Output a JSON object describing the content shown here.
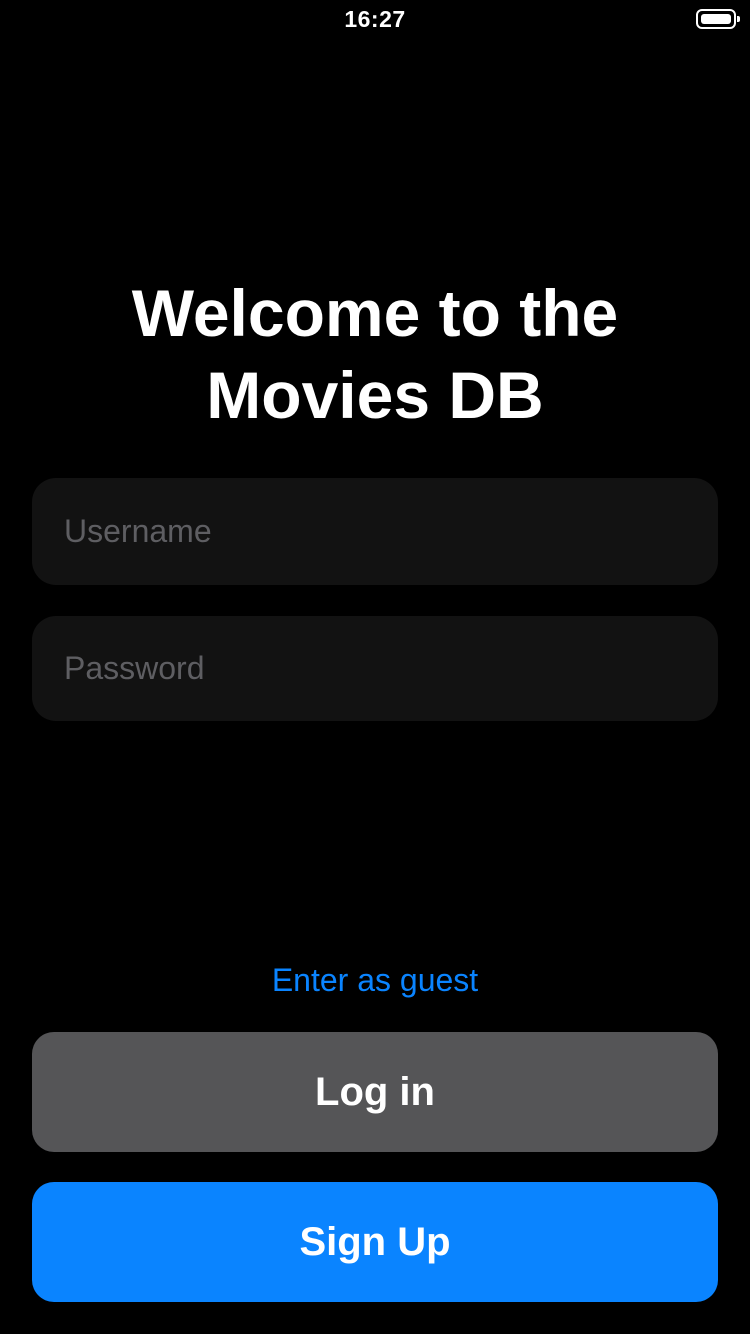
{
  "status_bar": {
    "time": "16:27",
    "battery_icon": "battery-full-icon"
  },
  "welcome": {
    "title_line1": "Welcome to the",
    "title_line2": "Movies DB"
  },
  "form": {
    "username_placeholder": "Username",
    "username_value": "",
    "password_placeholder": "Password",
    "password_value": ""
  },
  "actions": {
    "guest_label": "Enter as guest",
    "login_label": "Log in",
    "signup_label": "Sign Up"
  },
  "colors": {
    "background": "#000000",
    "field_background": "#121212",
    "accent": "#0a84ff",
    "login_button": "#555557"
  }
}
